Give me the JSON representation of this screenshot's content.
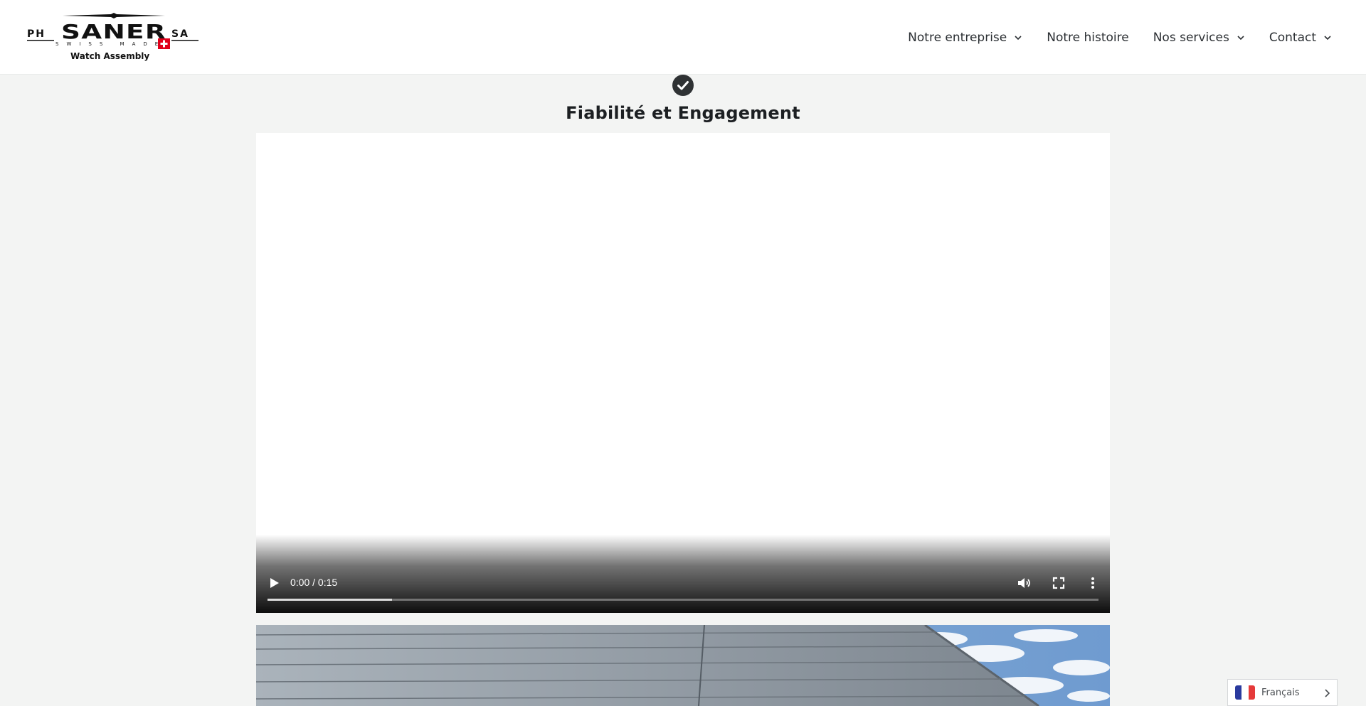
{
  "header": {
    "logo": {
      "brand_left": "PH",
      "brand_main": "SANER",
      "brand_right": "SA",
      "tagline": "SWISS MADE",
      "subtitle": "Watch Assembly"
    },
    "nav": [
      {
        "label": "Notre entreprise",
        "has_dropdown": true
      },
      {
        "label": "Notre histoire",
        "has_dropdown": false
      },
      {
        "label": "Nos services",
        "has_dropdown": true
      },
      {
        "label": "Contact",
        "has_dropdown": true
      }
    ]
  },
  "main": {
    "badge_icon": "check-circle-icon",
    "title": "Fiabilité et Engagement",
    "video": {
      "time": "0:00 / 0:15",
      "buffered_fraction": 0.15,
      "icons": [
        "play-icon",
        "volume-icon",
        "fullscreen-icon",
        "more-options-icon"
      ]
    }
  },
  "language": {
    "label": "Français",
    "flag": "french-flag-icon"
  },
  "colors": {
    "background": "#f3f4f3",
    "header_bg": "#ffffff",
    "text_dark": "#2b2f33",
    "badge": "#2f3234",
    "swiss_red": "#e1001a",
    "flag_blue": "#2a3a9e",
    "flag_red": "#e53a3a"
  }
}
